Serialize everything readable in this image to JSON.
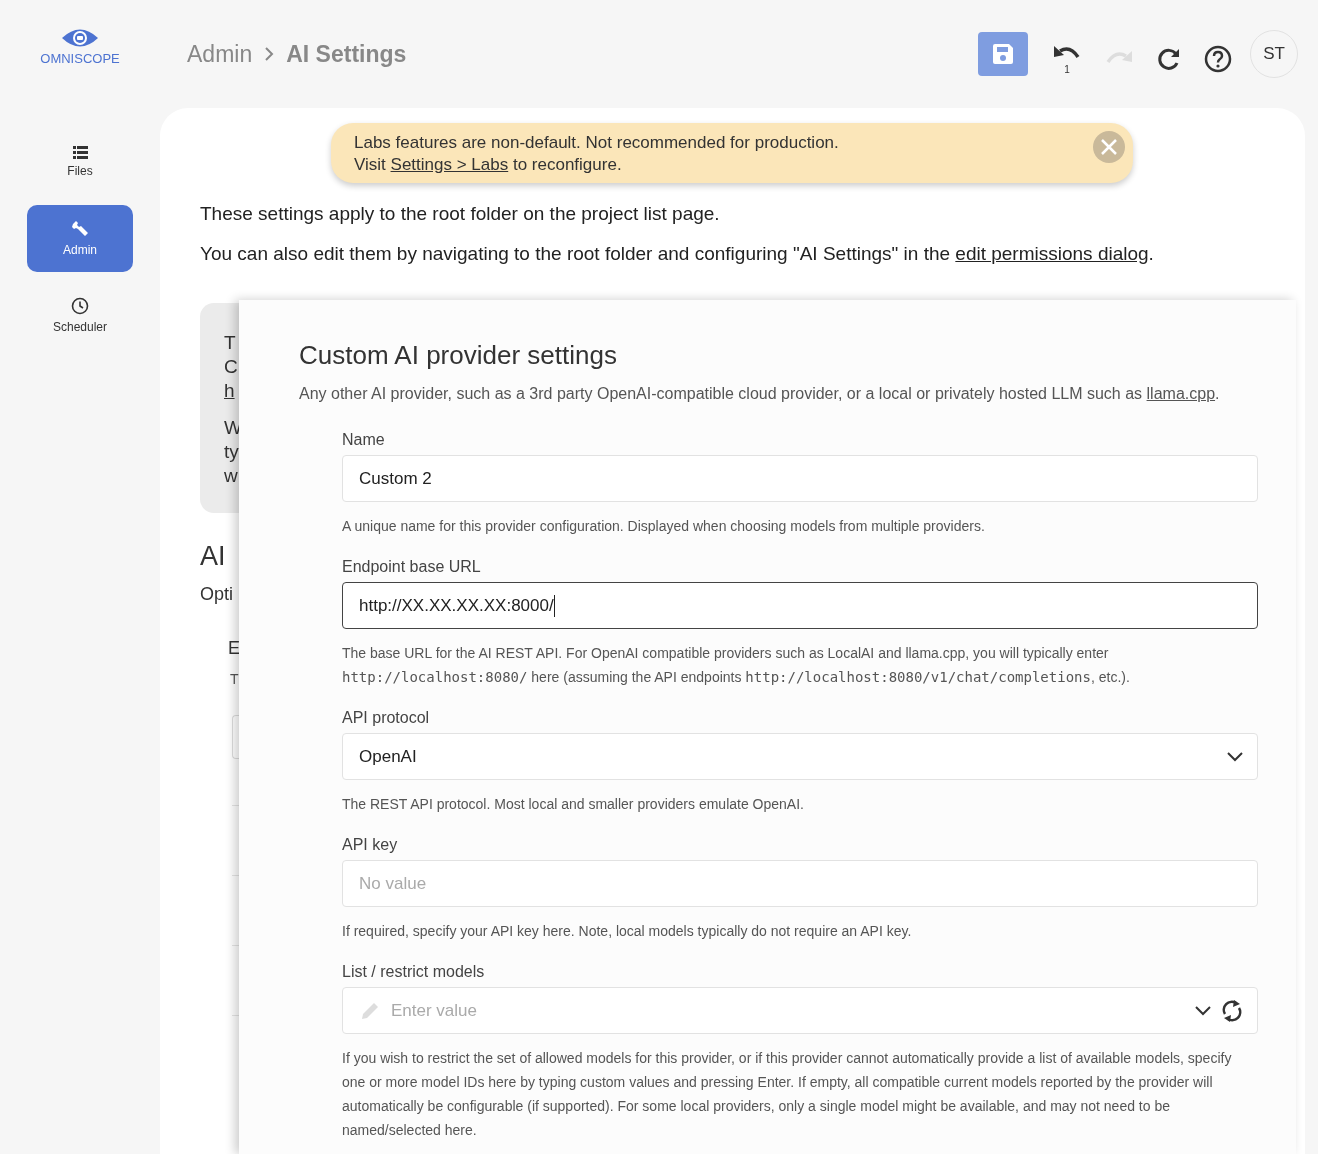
{
  "logo": {
    "text": "OMNISCOPE"
  },
  "sidebar": {
    "items": [
      {
        "label": "Files",
        "selected": false
      },
      {
        "label": "Admin",
        "selected": true
      },
      {
        "label": "Scheduler",
        "selected": false
      }
    ]
  },
  "breadcrumb": [
    "Admin",
    "AI Settings"
  ],
  "toolbar": [
    {
      "kind": "save",
      "disabled": false
    },
    {
      "kind": "undo",
      "disabled": false,
      "badge": "1"
    },
    {
      "kind": "redo",
      "disabled": true
    },
    {
      "kind": "refresh",
      "disabled": false
    },
    {
      "kind": "help",
      "disabled": false
    },
    {
      "kind": "avatar",
      "text": "ST"
    }
  ],
  "banner": {
    "line1": "Labs features are non-default. Not recommended for production.",
    "before": "Visit ",
    "link": "Settings > Labs",
    "after": " to reconfigure."
  },
  "intro": {
    "line1": "These settings apply to the root folder on the project list page.",
    "before": "You can also edit them by navigating to the root folder and configuring \"AI Settings\" in the ",
    "link": "edit permissions dialog",
    "after": "."
  },
  "background": {
    "notice_lines": [
      {
        "text": "T",
        "link": false
      },
      {
        "text": "C",
        "link": false
      },
      {
        "text": "h",
        "link": true
      },
      {
        "text": "W",
        "link": false
      },
      {
        "text": "ty",
        "link": false
      },
      {
        "text": "w",
        "link": false
      }
    ],
    "section_title": "AI",
    "section_text": "Opti",
    "field_label": "E",
    "field_text": "T"
  },
  "panel": {
    "title": "Custom AI provider settings",
    "description": "Any other AI provider, such as a 3rd party OpenAI-compatible cloud provider, or a local or privately hosted LLM such as ",
    "link": "llama.cpp",
    "after": ".",
    "fields": [
      {
        "kind": "text",
        "label": "Name",
        "value": "Custom 2",
        "focused": false,
        "help": [
          {
            "text": "A unique name for this provider configuration. Displayed when choosing models from multiple providers.",
            "code": false
          }
        ]
      },
      {
        "kind": "text",
        "label": "Endpoint base URL",
        "value": "http://XX.XX.XX.XX:8000/",
        "focused": true,
        "help": [
          {
            "text": "The base URL for the AI REST API. For OpenAI compatible providers such as LocalAI and llama.cpp, you will typically enter ",
            "code": false
          },
          {
            "text": "http://localhost:8080/",
            "code": true
          },
          {
            "text": " here (assuming the API endpoints ",
            "code": false
          },
          {
            "text": "http://localhost:8080/v1/chat/completions",
            "code": true
          },
          {
            "text": ", etc.).",
            "code": false
          }
        ]
      },
      {
        "kind": "select",
        "label": "API protocol",
        "value": "OpenAI",
        "focused": false,
        "help": [
          {
            "text": "The REST API protocol. Most local and smaller providers emulate OpenAI.",
            "code": false
          }
        ]
      },
      {
        "kind": "text",
        "label": "API key",
        "placeholder": "No value",
        "focused": false,
        "help": [
          {
            "text": "If required, specify your API key here. Note, local models typically do not require an API key.",
            "code": false
          }
        ]
      },
      {
        "kind": "tags",
        "label": "List / restrict models",
        "placeholder": "Enter value",
        "focused": false,
        "help": [
          {
            "text": "If you wish to restrict the set of allowed models for this provider, or if this provider cannot automatically provide a list of available models, specify one or more model IDs here by typing custom values and pressing Enter. If empty, all compatible current models reported by the provider will automatically be configurable (if supported). For some local providers, only a single model might be available, and may not need to be named/selected here.",
            "code": false
          }
        ]
      }
    ]
  }
}
